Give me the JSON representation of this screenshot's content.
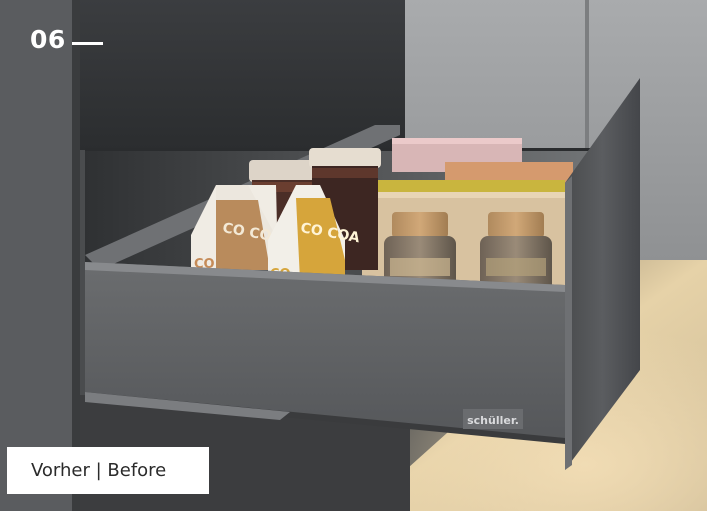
{
  "overlay": {
    "number": "06",
    "caption": "Vorher | Before"
  },
  "scene": {
    "items": {
      "carton_text": "CO COA",
      "carton_small_text": "CO",
      "brand_plate": "schüller."
    },
    "colors": {
      "drawer": "#4e5052",
      "wall": "#6c6e70",
      "cabinet_light": "#9a9c9e",
      "carton_brown": "#b98b5c",
      "carton_yellow": "#d6a53b",
      "warm_light": "#e9d3ab"
    }
  }
}
